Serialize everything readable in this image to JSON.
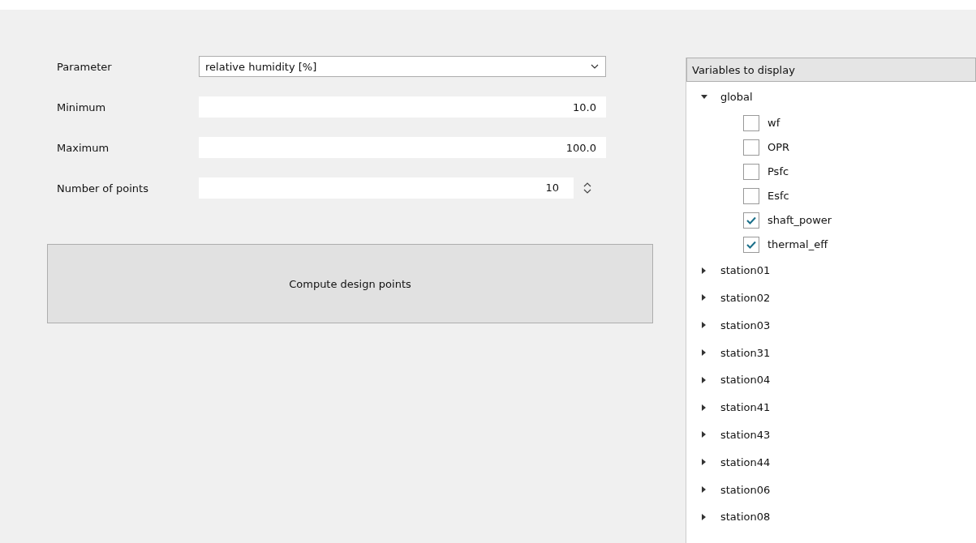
{
  "form": {
    "rows": [
      {
        "kind": "combo",
        "label": "Parameter",
        "value": "relative humidity [%]"
      },
      {
        "kind": "line",
        "label": "Minimum",
        "value": "10.0"
      },
      {
        "kind": "line",
        "label": "Maximum",
        "value": "100.0"
      },
      {
        "kind": "spin",
        "label": "Number of points",
        "value": "10"
      }
    ],
    "button": "Compute design points"
  },
  "tree": {
    "header": "Variables to display",
    "items": [
      {
        "label": "global",
        "expanded": true,
        "children": [
          {
            "label": "wf",
            "checked": false
          },
          {
            "label": "OPR",
            "checked": false
          },
          {
            "label": "Psfc",
            "checked": false
          },
          {
            "label": "Esfc",
            "checked": false
          },
          {
            "label": "shaft_power",
            "checked": true
          },
          {
            "label": "thermal_eff",
            "checked": true
          }
        ]
      },
      {
        "label": "station01",
        "expanded": false
      },
      {
        "label": "station02",
        "expanded": false
      },
      {
        "label": "station03",
        "expanded": false
      },
      {
        "label": "station31",
        "expanded": false
      },
      {
        "label": "station04",
        "expanded": false
      },
      {
        "label": "station41",
        "expanded": false
      },
      {
        "label": "station43",
        "expanded": false
      },
      {
        "label": "station44",
        "expanded": false
      },
      {
        "label": "station06",
        "expanded": false
      },
      {
        "label": "station08",
        "expanded": false
      }
    ]
  }
}
